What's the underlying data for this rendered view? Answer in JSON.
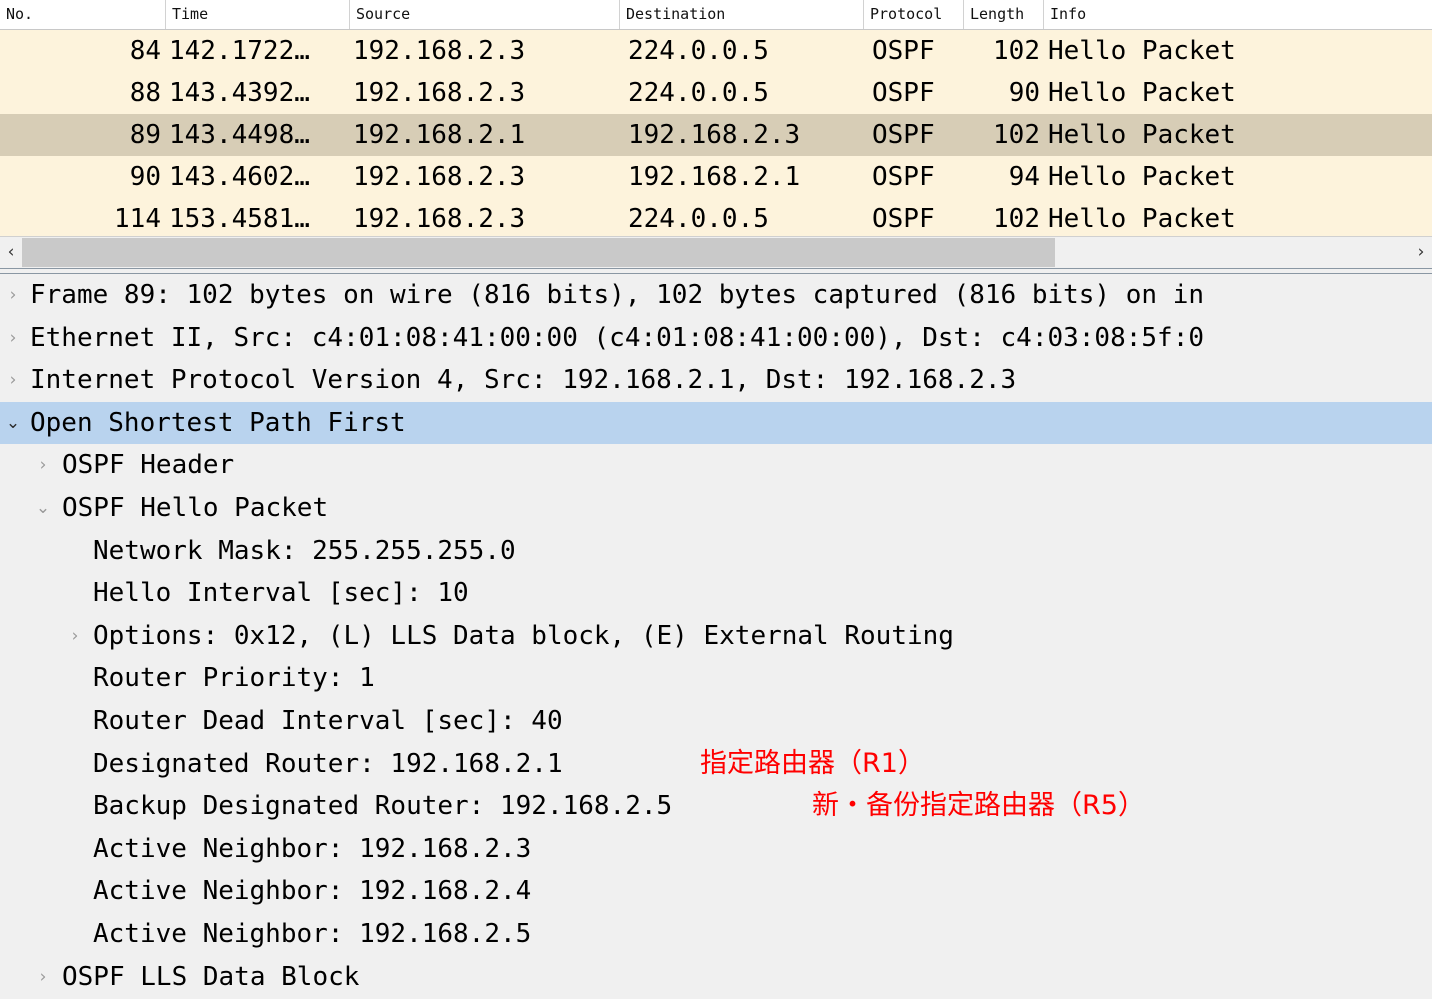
{
  "packet_list": {
    "columns": [
      {
        "key": "no",
        "label": "No."
      },
      {
        "key": "time",
        "label": "Time"
      },
      {
        "key": "source",
        "label": "Source"
      },
      {
        "key": "destination",
        "label": "Destination"
      },
      {
        "key": "protocol",
        "label": "Protocol"
      },
      {
        "key": "length",
        "label": "Length"
      },
      {
        "key": "info",
        "label": "Info"
      }
    ],
    "rows": [
      {
        "no": "84",
        "time": "142.1722…",
        "source": "192.168.2.3",
        "destination": "224.0.0.5",
        "protocol": "OSPF",
        "length": "102",
        "info": "Hello Packet",
        "selected": false
      },
      {
        "no": "88",
        "time": "143.4392…",
        "source": "192.168.2.3",
        "destination": "224.0.0.5",
        "protocol": "OSPF",
        "length": "90",
        "info": "Hello Packet",
        "selected": false
      },
      {
        "no": "89",
        "time": "143.4498…",
        "source": "192.168.2.1",
        "destination": "192.168.2.3",
        "protocol": "OSPF",
        "length": "102",
        "info": "Hello Packet",
        "selected": true
      },
      {
        "no": "90",
        "time": "143.4602…",
        "source": "192.168.2.3",
        "destination": "192.168.2.1",
        "protocol": "OSPF",
        "length": "94",
        "info": "Hello Packet",
        "selected": false
      },
      {
        "no": "114",
        "time": "153.4581…",
        "source": "192.168.2.3",
        "destination": "224.0.0.5",
        "protocol": "OSPF",
        "length": "102",
        "info": "Hello Packet",
        "selected": false
      }
    ]
  },
  "scrollbar": {
    "left_arrow": "‹",
    "right_arrow": "›"
  },
  "packet_detail": {
    "rows": [
      {
        "level": 0,
        "state": "collapsed",
        "expander": "›",
        "text": "Frame 89: 102 bytes on wire (816 bits), 102 bytes captured (816 bits) on in",
        "selected": false
      },
      {
        "level": 0,
        "state": "collapsed",
        "expander": "›",
        "text": "Ethernet II, Src: c4:01:08:41:00:00 (c4:01:08:41:00:00), Dst: c4:03:08:5f:0",
        "selected": false
      },
      {
        "level": 0,
        "state": "collapsed",
        "expander": "›",
        "text": "Internet Protocol Version 4, Src: 192.168.2.1, Dst: 192.168.2.3",
        "selected": false
      },
      {
        "level": 0,
        "state": "expanded",
        "expander": "⌄",
        "text": "Open Shortest Path First",
        "selected": true
      },
      {
        "level": 1,
        "state": "collapsed",
        "expander": "›",
        "text": "OSPF Header",
        "selected": false
      },
      {
        "level": 1,
        "state": "expanded",
        "expander": "⌄",
        "text": "OSPF Hello Packet",
        "selected": false
      },
      {
        "level": 2,
        "state": "leaf",
        "expander": "",
        "text": "Network Mask: 255.255.255.0",
        "selected": false
      },
      {
        "level": 2,
        "state": "leaf",
        "expander": "",
        "text": "Hello Interval [sec]: 10",
        "selected": false
      },
      {
        "level": 2,
        "state": "collapsed",
        "expander": "›",
        "text": "Options: 0x12, (L) LLS Data block, (E) External Routing",
        "selected": false
      },
      {
        "level": 2,
        "state": "leaf",
        "expander": "",
        "text": "Router Priority: 1",
        "selected": false
      },
      {
        "level": 2,
        "state": "leaf",
        "expander": "",
        "text": "Router Dead Interval [sec]: 40",
        "selected": false
      },
      {
        "level": 2,
        "state": "leaf",
        "expander": "",
        "text": "Designated Router: 192.168.2.1",
        "selected": false,
        "annotation": "指定路由器（R1）",
        "annotation_slot": "a1"
      },
      {
        "level": 2,
        "state": "leaf",
        "expander": "",
        "text": "Backup Designated Router: 192.168.2.5",
        "selected": false,
        "annotation": "新・备份指定路由器（R5）",
        "annotation_slot": "a2"
      },
      {
        "level": 2,
        "state": "leaf",
        "expander": "",
        "text": "Active Neighbor: 192.168.2.3",
        "selected": false
      },
      {
        "level": 2,
        "state": "leaf",
        "expander": "",
        "text": "Active Neighbor: 192.168.2.4",
        "selected": false
      },
      {
        "level": 2,
        "state": "leaf",
        "expander": "",
        "text": "Active Neighbor: 192.168.2.5",
        "selected": false
      },
      {
        "level": 1,
        "state": "collapsed",
        "expander": "›",
        "text": "OSPF LLS Data Block",
        "selected": false
      }
    ]
  },
  "colors": {
    "row_background": "#fdf3dc",
    "row_selected": "#d7cdb6",
    "detail_background": "#f0f0f0",
    "detail_selected": "#b9d3ee",
    "annotation": "#ff0000"
  }
}
